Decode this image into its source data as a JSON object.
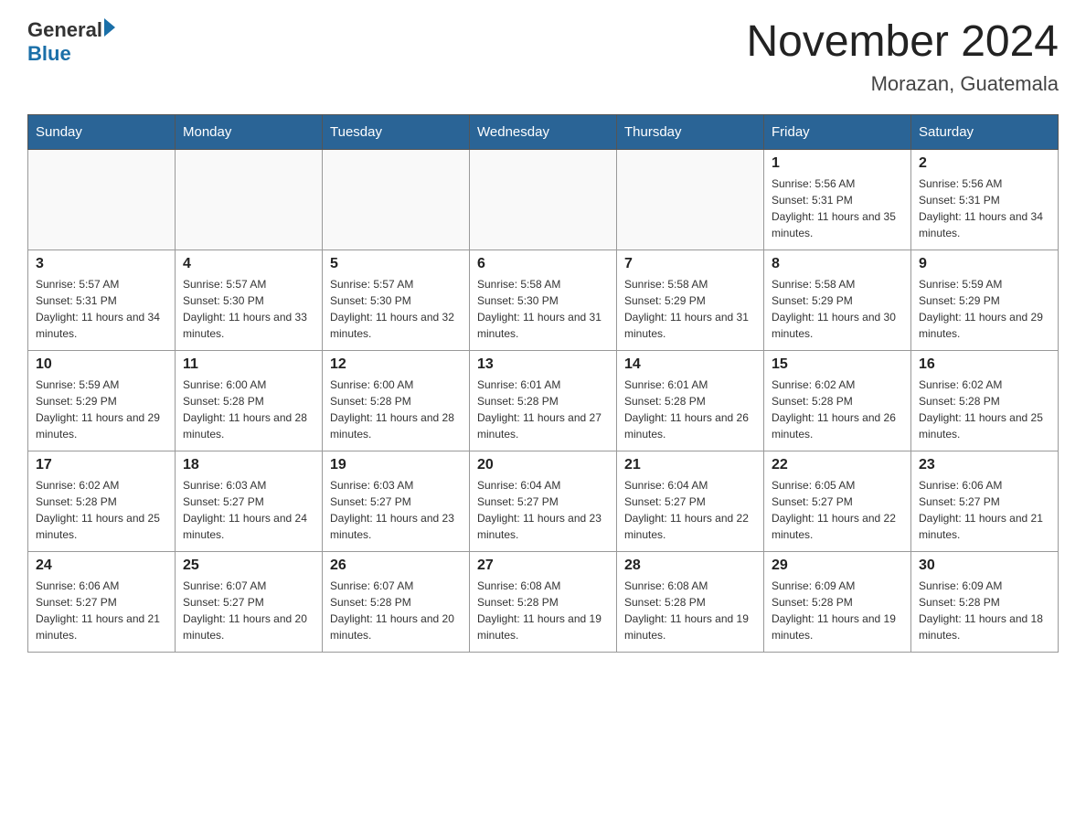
{
  "logo": {
    "general": "General",
    "blue": "Blue"
  },
  "title": {
    "month_year": "November 2024",
    "location": "Morazan, Guatemala"
  },
  "header_days": [
    "Sunday",
    "Monday",
    "Tuesday",
    "Wednesday",
    "Thursday",
    "Friday",
    "Saturday"
  ],
  "weeks": [
    [
      {
        "day": "",
        "info": ""
      },
      {
        "day": "",
        "info": ""
      },
      {
        "day": "",
        "info": ""
      },
      {
        "day": "",
        "info": ""
      },
      {
        "day": "",
        "info": ""
      },
      {
        "day": "1",
        "info": "Sunrise: 5:56 AM\nSunset: 5:31 PM\nDaylight: 11 hours and 35 minutes."
      },
      {
        "day": "2",
        "info": "Sunrise: 5:56 AM\nSunset: 5:31 PM\nDaylight: 11 hours and 34 minutes."
      }
    ],
    [
      {
        "day": "3",
        "info": "Sunrise: 5:57 AM\nSunset: 5:31 PM\nDaylight: 11 hours and 34 minutes."
      },
      {
        "day": "4",
        "info": "Sunrise: 5:57 AM\nSunset: 5:30 PM\nDaylight: 11 hours and 33 minutes."
      },
      {
        "day": "5",
        "info": "Sunrise: 5:57 AM\nSunset: 5:30 PM\nDaylight: 11 hours and 32 minutes."
      },
      {
        "day": "6",
        "info": "Sunrise: 5:58 AM\nSunset: 5:30 PM\nDaylight: 11 hours and 31 minutes."
      },
      {
        "day": "7",
        "info": "Sunrise: 5:58 AM\nSunset: 5:29 PM\nDaylight: 11 hours and 31 minutes."
      },
      {
        "day": "8",
        "info": "Sunrise: 5:58 AM\nSunset: 5:29 PM\nDaylight: 11 hours and 30 minutes."
      },
      {
        "day": "9",
        "info": "Sunrise: 5:59 AM\nSunset: 5:29 PM\nDaylight: 11 hours and 29 minutes."
      }
    ],
    [
      {
        "day": "10",
        "info": "Sunrise: 5:59 AM\nSunset: 5:29 PM\nDaylight: 11 hours and 29 minutes."
      },
      {
        "day": "11",
        "info": "Sunrise: 6:00 AM\nSunset: 5:28 PM\nDaylight: 11 hours and 28 minutes."
      },
      {
        "day": "12",
        "info": "Sunrise: 6:00 AM\nSunset: 5:28 PM\nDaylight: 11 hours and 28 minutes."
      },
      {
        "day": "13",
        "info": "Sunrise: 6:01 AM\nSunset: 5:28 PM\nDaylight: 11 hours and 27 minutes."
      },
      {
        "day": "14",
        "info": "Sunrise: 6:01 AM\nSunset: 5:28 PM\nDaylight: 11 hours and 26 minutes."
      },
      {
        "day": "15",
        "info": "Sunrise: 6:02 AM\nSunset: 5:28 PM\nDaylight: 11 hours and 26 minutes."
      },
      {
        "day": "16",
        "info": "Sunrise: 6:02 AM\nSunset: 5:28 PM\nDaylight: 11 hours and 25 minutes."
      }
    ],
    [
      {
        "day": "17",
        "info": "Sunrise: 6:02 AM\nSunset: 5:28 PM\nDaylight: 11 hours and 25 minutes."
      },
      {
        "day": "18",
        "info": "Sunrise: 6:03 AM\nSunset: 5:27 PM\nDaylight: 11 hours and 24 minutes."
      },
      {
        "day": "19",
        "info": "Sunrise: 6:03 AM\nSunset: 5:27 PM\nDaylight: 11 hours and 23 minutes."
      },
      {
        "day": "20",
        "info": "Sunrise: 6:04 AM\nSunset: 5:27 PM\nDaylight: 11 hours and 23 minutes."
      },
      {
        "day": "21",
        "info": "Sunrise: 6:04 AM\nSunset: 5:27 PM\nDaylight: 11 hours and 22 minutes."
      },
      {
        "day": "22",
        "info": "Sunrise: 6:05 AM\nSunset: 5:27 PM\nDaylight: 11 hours and 22 minutes."
      },
      {
        "day": "23",
        "info": "Sunrise: 6:06 AM\nSunset: 5:27 PM\nDaylight: 11 hours and 21 minutes."
      }
    ],
    [
      {
        "day": "24",
        "info": "Sunrise: 6:06 AM\nSunset: 5:27 PM\nDaylight: 11 hours and 21 minutes."
      },
      {
        "day": "25",
        "info": "Sunrise: 6:07 AM\nSunset: 5:27 PM\nDaylight: 11 hours and 20 minutes."
      },
      {
        "day": "26",
        "info": "Sunrise: 6:07 AM\nSunset: 5:28 PM\nDaylight: 11 hours and 20 minutes."
      },
      {
        "day": "27",
        "info": "Sunrise: 6:08 AM\nSunset: 5:28 PM\nDaylight: 11 hours and 19 minutes."
      },
      {
        "day": "28",
        "info": "Sunrise: 6:08 AM\nSunset: 5:28 PM\nDaylight: 11 hours and 19 minutes."
      },
      {
        "day": "29",
        "info": "Sunrise: 6:09 AM\nSunset: 5:28 PM\nDaylight: 11 hours and 19 minutes."
      },
      {
        "day": "30",
        "info": "Sunrise: 6:09 AM\nSunset: 5:28 PM\nDaylight: 11 hours and 18 minutes."
      }
    ]
  ]
}
